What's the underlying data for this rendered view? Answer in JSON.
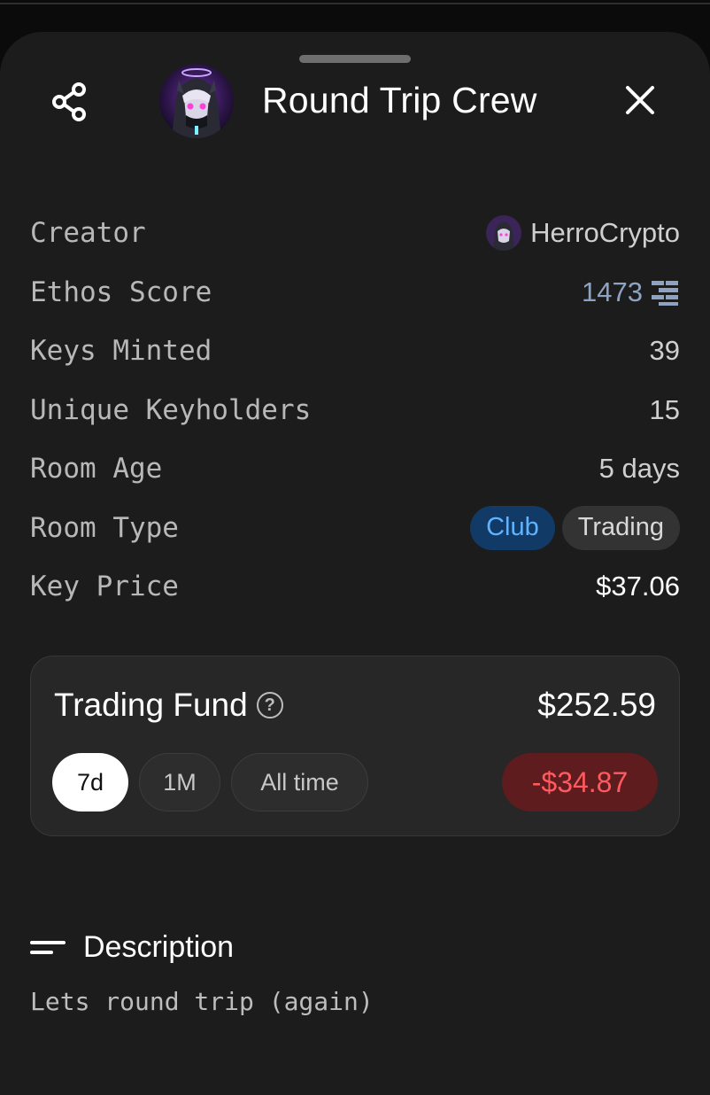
{
  "header": {
    "title": "Round Trip Crew"
  },
  "details": {
    "creator": {
      "label": "Creator",
      "value": "HerroCrypto"
    },
    "ethos_score": {
      "label": "Ethos Score",
      "value": "1473"
    },
    "keys_minted": {
      "label": "Keys Minted",
      "value": "39"
    },
    "unique_keyholders": {
      "label": "Unique Keyholders",
      "value": "15"
    },
    "room_age": {
      "label": "Room Age",
      "value": "5 days"
    },
    "room_type": {
      "label": "Room Type",
      "tags": [
        "Club",
        "Trading"
      ]
    },
    "key_price": {
      "label": "Key Price",
      "value": "$37.06"
    }
  },
  "trading_fund": {
    "title": "Trading Fund",
    "value": "$252.59",
    "periods": [
      "7d",
      "1M",
      "All time"
    ],
    "selected_period": "7d",
    "change": "-$34.87"
  },
  "description": {
    "heading": "Description",
    "text": "Lets round trip (again)"
  },
  "colors": {
    "sheet_bg": "#1c1c1c",
    "accent_blue": "#5fb3ff",
    "negative": "#ff5a5f",
    "ethos_blue": "#8da3c4"
  },
  "icons": [
    "share-icon",
    "close-icon",
    "help-circle-icon",
    "ethos-logo-icon",
    "text-lines-icon"
  ]
}
